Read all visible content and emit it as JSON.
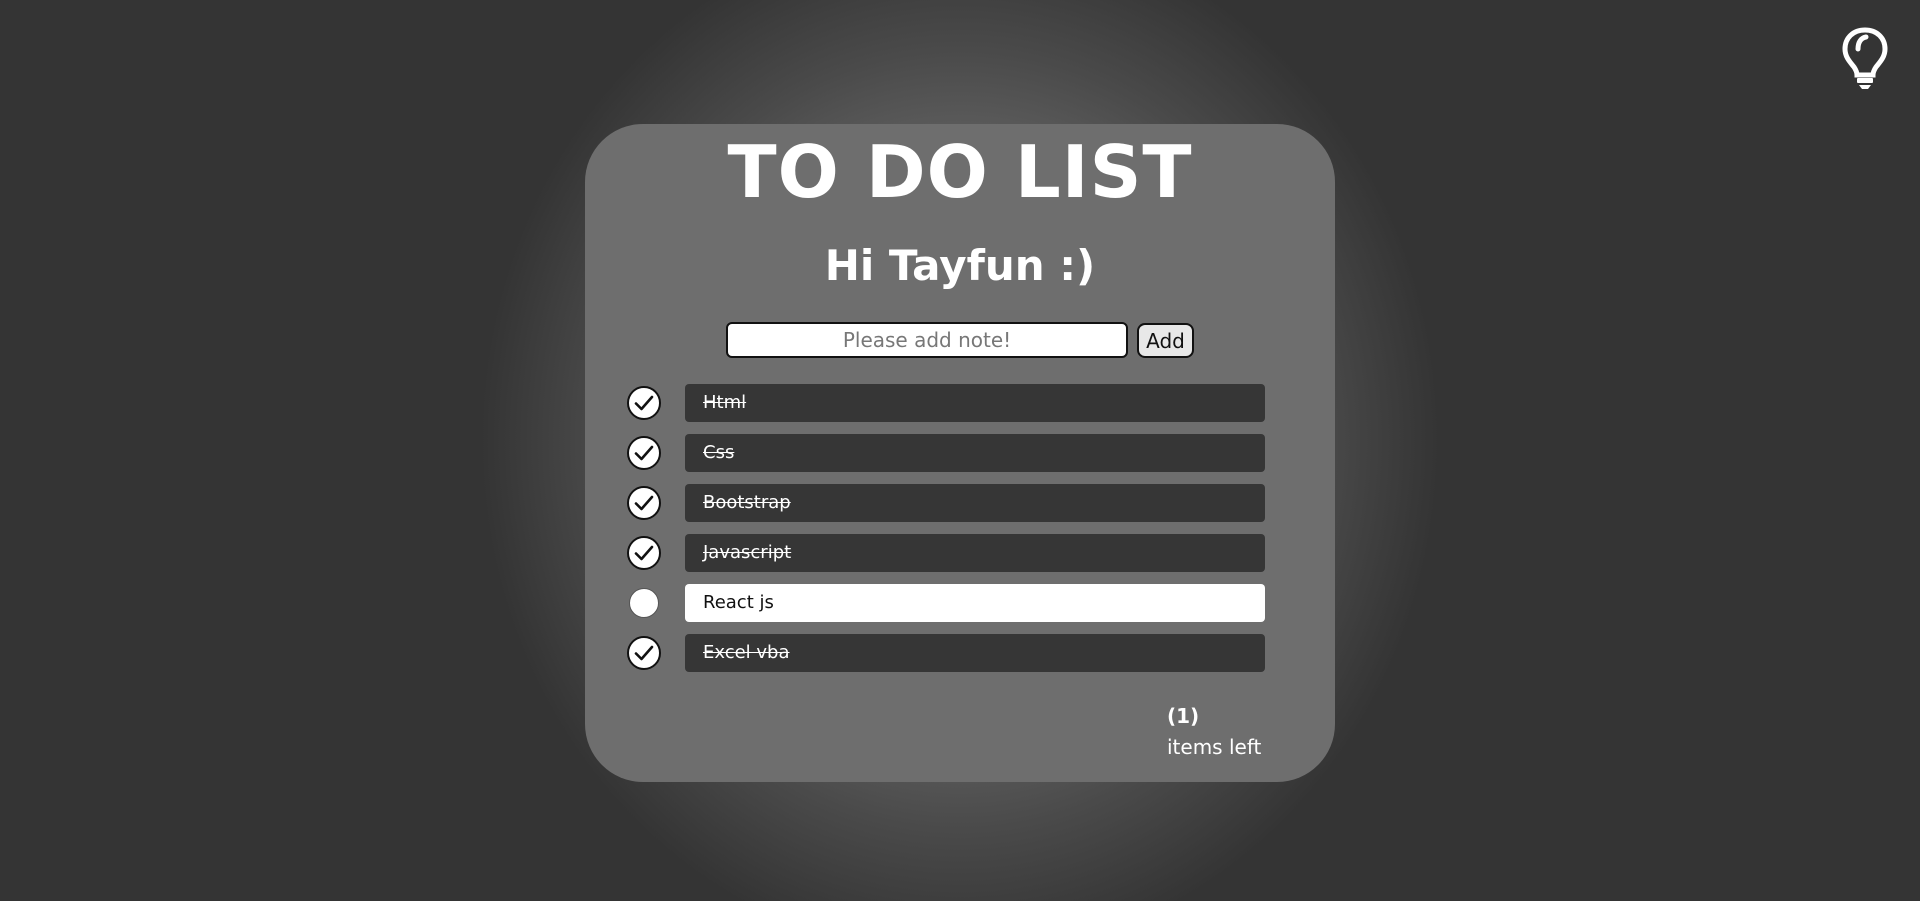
{
  "header": {
    "title": "TO DO LIST",
    "greeting": "Hi Tayfun :)",
    "theme_toggle_icon": "lightbulb-icon"
  },
  "form": {
    "input_value": "",
    "input_placeholder": "Please add note!",
    "add_label": "Add"
  },
  "todos": [
    {
      "text": "Html",
      "done": true
    },
    {
      "text": "Css",
      "done": true
    },
    {
      "text": "Bootstrap",
      "done": true
    },
    {
      "text": "Javascript",
      "done": true
    },
    {
      "text": "React js",
      "done": false
    },
    {
      "text": "Excel vba",
      "done": true
    }
  ],
  "footer": {
    "count": "(1)",
    "items_left_label": "items left"
  },
  "colors": {
    "page_background": "#343434",
    "card_background": "#6e6e6e",
    "done_item_background": "#363636",
    "open_item_background": "#ffffff",
    "text_light": "#ffffff"
  }
}
